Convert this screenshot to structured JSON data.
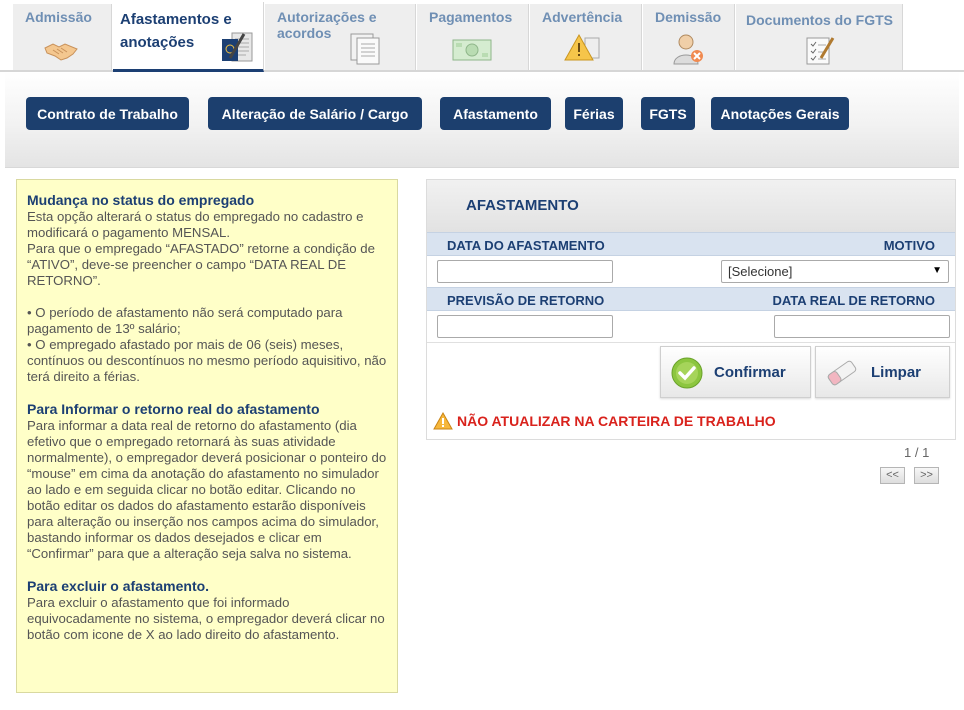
{
  "tabs": [
    {
      "label": "Admissão",
      "icon": "handshake-icon"
    },
    {
      "label": "Afastamentos e anotações",
      "icon": "passport-pen-icon",
      "active": true
    },
    {
      "label": "Autorizações e acordos",
      "icon": "documents-icon"
    },
    {
      "label": "Pagamentos",
      "icon": "money-icon"
    },
    {
      "label": "Advertência",
      "icon": "warning-sign-icon"
    },
    {
      "label": "Demissão",
      "icon": "person-remove-icon"
    },
    {
      "label": "Documentos do FGTS",
      "icon": "checklist-icon"
    }
  ],
  "subnav": [
    {
      "label": "Contrato de Trabalho"
    },
    {
      "label": "Alteração de Salário / Cargo"
    },
    {
      "label": "Afastamento"
    },
    {
      "label": "Férias"
    },
    {
      "label": "FGTS"
    },
    {
      "label": "Anotações Gerais"
    }
  ],
  "info": {
    "s1_title": "Mudança no status do empregado",
    "s1_p1": "Esta opção alterará o status do empregado no cadastro e modificará o pagamento MENSAL.",
    "s1_p2": "Para que o empregado “AFASTADO” retorne a condição de “ATIVO”, deve-se preencher o campo “DATA REAL DE RETORNO”.",
    "s1_b1": "• O período de afastamento não será computado para pagamento de 13º salário;",
    "s1_b2": "• O empregado afastado por mais de 06 (seis) meses, contínuos ou descontínuos no mesmo período aquisitivo, não terá direito a férias.",
    "s2_title": "Para Informar o retorno real do afastamento",
    "s2_p": "Para informar a data real de retorno do afastamento (dia efetivo que o empregado retornará às suas atividade normalmente), o empregador deverá posicionar o ponteiro do “mouse” em cima da anotação do afastamento no simulador ao lado e em seguida clicar no botão editar. Clicando no botão editar os dados do afastamento estarão disponíveis para alteração ou inserção nos campos acima do simulador, bastando informar os dados desejados e clicar em “Confirmar” para que a alteração seja salva no sistema.",
    "s3_title": "Para excluir o afastamento.",
    "s3_p": "Para excluir o afastamento que foi informado equivocadamente no sistema, o empregador deverá clicar no botão com icone de X ao lado direito do afastamento."
  },
  "form": {
    "title": "AFASTAMENTO",
    "label_data": "DATA DO AFASTAMENTO",
    "label_motivo": "MOTIVO",
    "data_value": "",
    "motivo_selected": "[Selecione]",
    "label_previsao": "PREVISÃO DE RETORNO",
    "label_real": "DATA REAL DE RETORNO",
    "previsao_value": "",
    "real_value": "",
    "confirm_label": "Confirmar",
    "clear_label": "Limpar",
    "warning": "NÃO ATUALIZAR NA CARTEIRA DE TRABALHO"
  },
  "pager": {
    "count": "1 / 1",
    "prev": "<<",
    "next": ">>"
  }
}
